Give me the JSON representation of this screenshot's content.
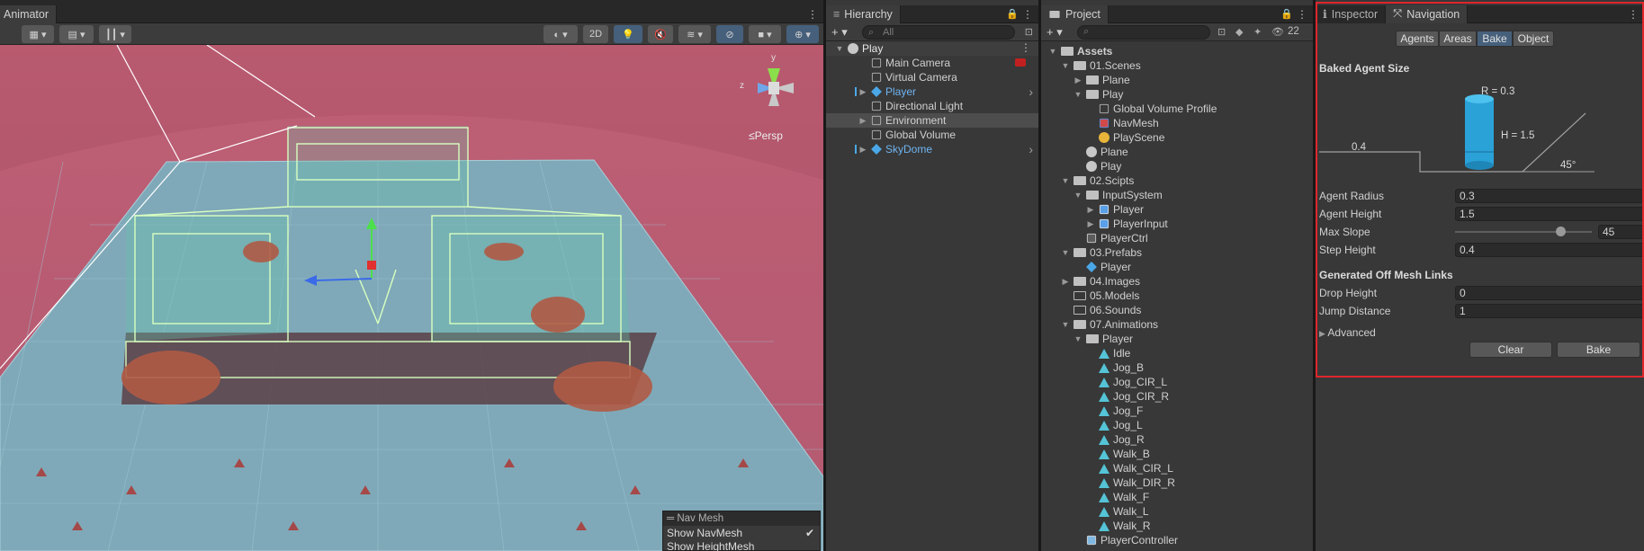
{
  "scene_view": {
    "tab_label": "Animator",
    "toolbar": {
      "two_d_label": "2D"
    },
    "persp_label": "≤Persp",
    "gizmo_y": "y",
    "gizmo_z": "z",
    "navmesh_overlay": {
      "title": "Nav Mesh",
      "show_navmesh": "Show NavMesh",
      "show_heightmesh": "Show HeightMesh",
      "show_navmesh_checked": true
    }
  },
  "hierarchy": {
    "tab_label": "Hierarchy",
    "search_placeholder": "All",
    "root": "Play",
    "items": [
      {
        "label": "Main Camera",
        "type": "gameobject",
        "expandable": false,
        "highlight": false,
        "selected": false
      },
      {
        "label": "Virtual Camera",
        "type": "gameobject",
        "expandable": false,
        "highlight": false,
        "selected": false
      },
      {
        "label": "Player",
        "type": "prefab",
        "expandable": true,
        "highlight": true,
        "selected": false
      },
      {
        "label": "Directional Light",
        "type": "gameobject",
        "expandable": false,
        "highlight": false,
        "selected": false
      },
      {
        "label": "Environment",
        "type": "gameobject",
        "expandable": true,
        "highlight": false,
        "selected": true
      },
      {
        "label": "Global Volume",
        "type": "gameobject",
        "expandable": false,
        "highlight": false,
        "selected": false
      },
      {
        "label": "SkyDome",
        "type": "prefab",
        "expandable": true,
        "highlight": true,
        "selected": false
      }
    ]
  },
  "project": {
    "tab_label": "Project",
    "layer_count": "22",
    "tree": [
      {
        "label": "Assets",
        "depth": 0,
        "icon": "folder-open",
        "arrow": "down",
        "bold": true
      },
      {
        "label": "01.Scenes",
        "depth": 1,
        "icon": "folder-open",
        "arrow": "down"
      },
      {
        "label": "Plane",
        "depth": 2,
        "icon": "folder",
        "arrow": "right"
      },
      {
        "label": "Play",
        "depth": 2,
        "icon": "folder-open",
        "arrow": "down"
      },
      {
        "label": "Global Volume Profile",
        "depth": 3,
        "icon": "file",
        "arrow": ""
      },
      {
        "label": "NavMesh",
        "depth": 3,
        "icon": "navmesh",
        "arrow": ""
      },
      {
        "label": "PlayScene",
        "depth": 3,
        "icon": "lighting",
        "arrow": ""
      },
      {
        "label": "Plane",
        "depth": 2,
        "icon": "scene",
        "arrow": ""
      },
      {
        "label": "Play",
        "depth": 2,
        "icon": "scene",
        "arrow": ""
      },
      {
        "label": "02.Scipts",
        "depth": 1,
        "icon": "folder-open",
        "arrow": "down"
      },
      {
        "label": "InputSystem",
        "depth": 2,
        "icon": "folder-open",
        "arrow": "down"
      },
      {
        "label": "Player",
        "depth": 3,
        "icon": "input",
        "arrow": "right"
      },
      {
        "label": "PlayerInput",
        "depth": 3,
        "icon": "input",
        "arrow": "right"
      },
      {
        "label": "PlayerCtrl",
        "depth": 2,
        "icon": "script",
        "arrow": ""
      },
      {
        "label": "03.Prefabs",
        "depth": 1,
        "icon": "folder-open",
        "arrow": "down"
      },
      {
        "label": "Player",
        "depth": 2,
        "icon": "prefab",
        "arrow": ""
      },
      {
        "label": "04.Images",
        "depth": 1,
        "icon": "folder",
        "arrow": "right"
      },
      {
        "label": "05.Models",
        "depth": 1,
        "icon": "folder-empty",
        "arrow": ""
      },
      {
        "label": "06.Sounds",
        "depth": 1,
        "icon": "folder-empty",
        "arrow": ""
      },
      {
        "label": "07.Animations",
        "depth": 1,
        "icon": "folder-open",
        "arrow": "down"
      },
      {
        "label": "Player",
        "depth": 2,
        "icon": "folder-open",
        "arrow": "down"
      },
      {
        "label": "Idle",
        "depth": 3,
        "icon": "anim",
        "arrow": ""
      },
      {
        "label": "Jog_B",
        "depth": 3,
        "icon": "anim",
        "arrow": ""
      },
      {
        "label": "Jog_CIR_L",
        "depth": 3,
        "icon": "anim",
        "arrow": ""
      },
      {
        "label": "Jog_CIR_R",
        "depth": 3,
        "icon": "anim",
        "arrow": ""
      },
      {
        "label": "Jog_F",
        "depth": 3,
        "icon": "anim",
        "arrow": ""
      },
      {
        "label": "Jog_L",
        "depth": 3,
        "icon": "anim",
        "arrow": ""
      },
      {
        "label": "Jog_R",
        "depth": 3,
        "icon": "anim",
        "arrow": ""
      },
      {
        "label": "Walk_B",
        "depth": 3,
        "icon": "anim",
        "arrow": ""
      },
      {
        "label": "Walk_CIR_L",
        "depth": 3,
        "icon": "anim",
        "arrow": ""
      },
      {
        "label": "Walk_DIR_R",
        "depth": 3,
        "icon": "anim",
        "arrow": ""
      },
      {
        "label": "Walk_F",
        "depth": 3,
        "icon": "anim",
        "arrow": ""
      },
      {
        "label": "Walk_L",
        "depth": 3,
        "icon": "anim",
        "arrow": ""
      },
      {
        "label": "Walk_R",
        "depth": 3,
        "icon": "anim",
        "arrow": ""
      },
      {
        "label": "PlayerController",
        "depth": 2,
        "icon": "controller",
        "arrow": ""
      }
    ]
  },
  "inspector": {
    "tab_inspector": "Inspector",
    "tab_navigation": "Navigation",
    "nav_tabs": [
      "Agents",
      "Areas",
      "Bake",
      "Object"
    ],
    "active_nav_tab": "Bake",
    "baked_agent_size_title": "Baked Agent Size",
    "diagram": {
      "r_label": "R = 0.3",
      "h_label": "H = 1.5",
      "step_label": "0.4",
      "slope_label": "45°"
    },
    "fields": [
      {
        "label": "Agent Radius",
        "value": "0.3"
      },
      {
        "label": "Agent Height",
        "value": "1.5"
      },
      {
        "label": "Max Slope",
        "value": "45",
        "slider_fraction": 0.77
      },
      {
        "label": "Step Height",
        "value": "0.4"
      }
    ],
    "offmesh_title": "Generated Off Mesh Links",
    "offmesh_fields": [
      {
        "label": "Drop Height",
        "value": "0"
      },
      {
        "label": "Jump Distance",
        "value": "1"
      }
    ],
    "advanced_label": "Advanced",
    "clear_button": "Clear",
    "bake_button": "Bake",
    "highlight_color": "#e0262b"
  },
  "colors": {
    "accent": "#4aa8e8",
    "link": "#6fb4f0",
    "scene_bg": "#b45a6c",
    "navmesh": "#8ecae0"
  }
}
